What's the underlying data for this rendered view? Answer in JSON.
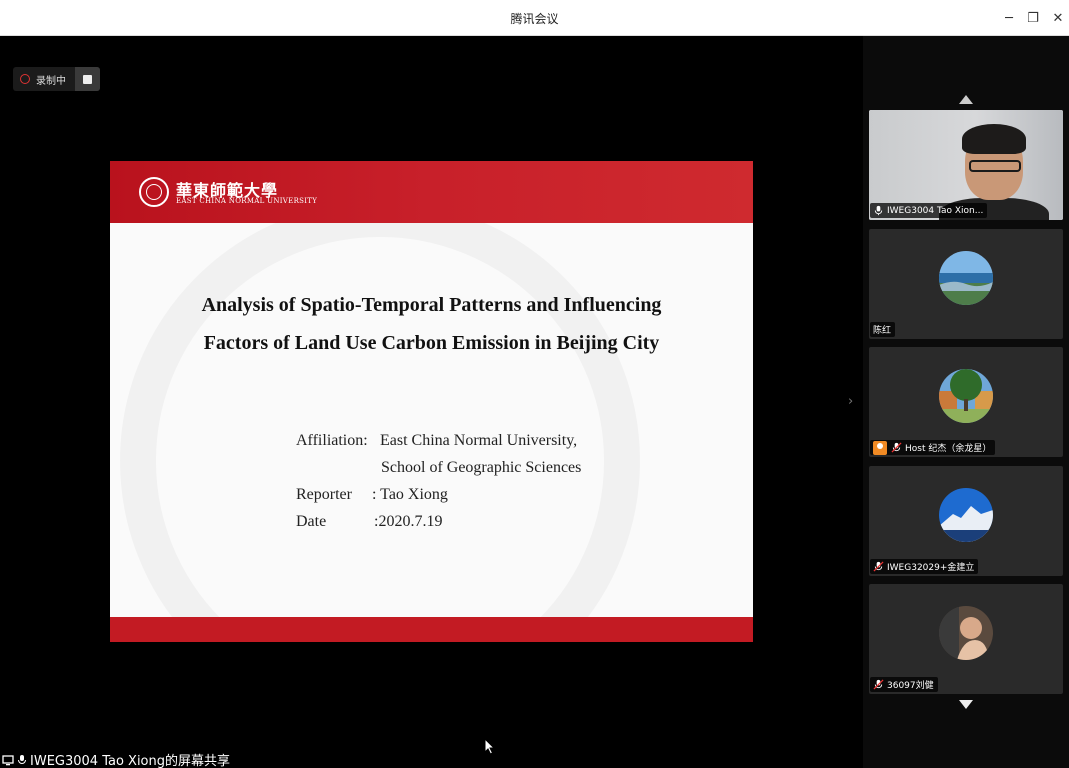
{
  "window": {
    "title": "腾讯会议",
    "controls": {
      "minimize": "─",
      "restore": "❐",
      "close": "✕"
    }
  },
  "recording": {
    "label": "录制中"
  },
  "slide": {
    "university_cn": "華東師範大學",
    "university_en": "EAST CHINA NORMAL UNIVERSITY",
    "title_line1": "Analysis of  Spatio-Temporal Patterns and Influencing",
    "title_line2": "Factors of Land Use Carbon Emission in Beijing City",
    "affiliation_label": "Affiliation:",
    "affiliation_value1": "East China Normal University,",
    "affiliation_value2": "School of Geographic  Sciences",
    "reporter_label": "Reporter",
    "reporter_value": ": Tao Xiong",
    "date_label": "Date",
    "date_value": ":2020.7.19"
  },
  "participants": [
    {
      "name": "IWEG3004 Tao Xion...",
      "video": true
    },
    {
      "name": "陈红",
      "video": false
    },
    {
      "name": "Host 纪杰（余龙星）",
      "video": false,
      "host": true
    },
    {
      "name": "IWEG32029+金建立",
      "video": false
    },
    {
      "name": "36097刘健",
      "video": false
    }
  ],
  "share": {
    "label": "IWEG3004 Tao Xiong的屏幕共享"
  },
  "colors": {
    "slide_red": "#c31b23",
    "host_orange": "#f08a24"
  }
}
